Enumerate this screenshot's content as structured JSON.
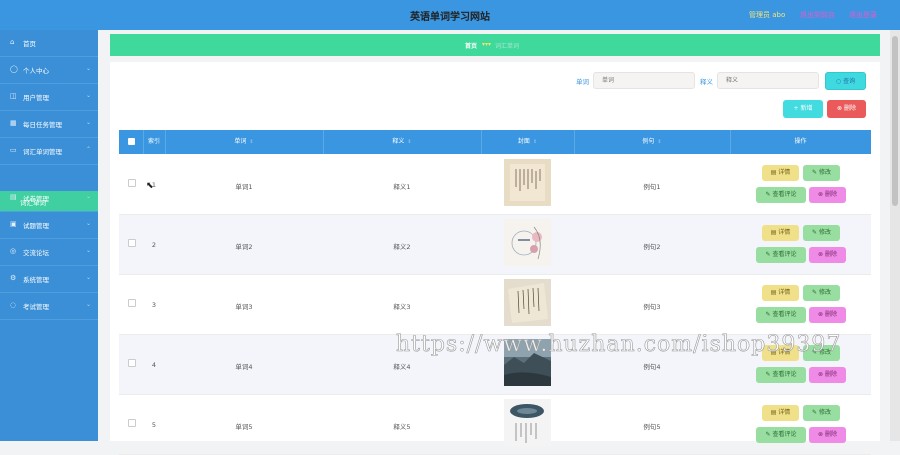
{
  "header": {
    "title": "英语单词学习网站",
    "admin": "管理员 abo",
    "exit_front": "退出到前台",
    "logout": "退出登录"
  },
  "sidebar": {
    "items": [
      {
        "label": "首页",
        "icon": "home-icon",
        "has_children": false
      },
      {
        "label": "个人中心",
        "icon": "user-icon",
        "has_children": true
      },
      {
        "label": "用户管理",
        "icon": "users-icon",
        "has_children": true
      },
      {
        "label": "每日任务管理",
        "icon": "task-icon",
        "has_children": true
      },
      {
        "label": "词汇单词管理",
        "icon": "book-icon",
        "has_children": true
      },
      {
        "label": "试卷管理",
        "icon": "paper-icon",
        "has_children": true
      },
      {
        "label": "试题管理",
        "icon": "question-icon",
        "has_children": true
      },
      {
        "label": "交流论坛",
        "icon": "forum-icon",
        "has_children": true
      },
      {
        "label": "系统管理",
        "icon": "settings-icon",
        "has_children": true
      },
      {
        "label": "考试管理",
        "icon": "exam-icon",
        "has_children": true
      }
    ],
    "active_sub": "词汇单词"
  },
  "breadcrumb": {
    "home": "首页",
    "separator": "▾▾▾",
    "current": "词汇单词"
  },
  "search": {
    "word_label": "单词",
    "word_placeholder": "单词",
    "meaning_label": "释义",
    "meaning_placeholder": "释义",
    "query_button": "○ 查询"
  },
  "toolbar": {
    "add_label": "+ 新增",
    "delete_label": "⊗ 删除"
  },
  "table": {
    "columns": {
      "index": "索引",
      "word": "单词",
      "meaning": "释义",
      "image": "封面",
      "example": "例句",
      "action": "操作"
    },
    "rows": [
      {
        "index": "1",
        "word": "单词1",
        "meaning": "释义1",
        "example": "例句1"
      },
      {
        "index": "2",
        "word": "单词2",
        "meaning": "释义2",
        "example": "例句2"
      },
      {
        "index": "3",
        "word": "单词3",
        "meaning": "释义3",
        "example": "例句3"
      },
      {
        "index": "4",
        "word": "单词4",
        "meaning": "释义4",
        "example": "例句4"
      },
      {
        "index": "5",
        "word": "单词5",
        "meaning": "释义5",
        "example": "例句5"
      }
    ],
    "actions": {
      "detail": "▤ 详情",
      "edit": "✎ 修改",
      "comment": "✎ 查看评论",
      "delete": "⊗ 删除"
    }
  },
  "watermark": "https://www.huzhan.com/ishop39397",
  "colors": {
    "header": "#3a96e0",
    "sidebar": "#3a8fd6",
    "accent_green": "#3fd99b",
    "danger": "#ea5a5a"
  }
}
